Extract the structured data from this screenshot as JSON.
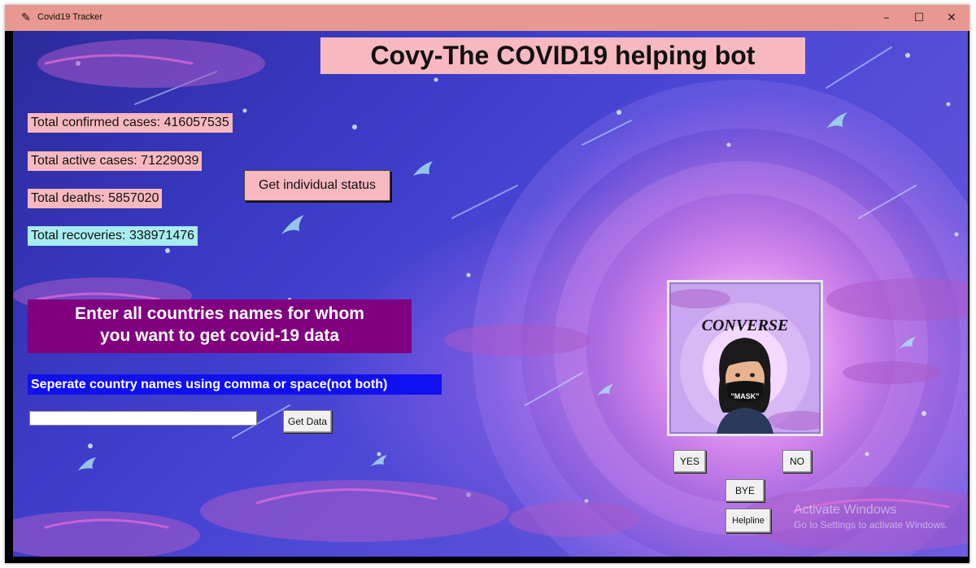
{
  "window": {
    "title": "Covid19 Tracker",
    "minimize_glyph": "–",
    "maximize_glyph": "☐",
    "close_glyph": "✕",
    "app_icon_glyph": "✎"
  },
  "heading": "Covy-The COVID19 helping bot",
  "stats": {
    "confirmed": "Total confirmed cases: 416057535",
    "active": "Total active cases: 71229039",
    "deaths": "Total deaths: 5857020",
    "recoveries": "Total recoveries: 338971476"
  },
  "individual_button": "Get individual status",
  "prompt": {
    "line1": "Enter all countries names for whom",
    "line2": "you want to get covid-19 data"
  },
  "separator_hint": "Seperate country names using comma or space(not both)",
  "country_input": {
    "value": "",
    "placeholder": ""
  },
  "get_data_button": "Get Data",
  "converse": {
    "title": "CONVERSE",
    "mask_text": "\"MASK\""
  },
  "buttons": {
    "yes": "YES",
    "no": "NO",
    "bye": "BYE",
    "helpline": "Helpline"
  },
  "watermark": {
    "line1": "Activate Windows",
    "line2": "Go to Settings to activate Windows."
  },
  "colors": {
    "titlebar": "#e89890",
    "pink_label": "#f7b8c0",
    "cyan_label": "#a8ecf0",
    "purple_box": "#800080",
    "blue_label": "#1010f0"
  }
}
